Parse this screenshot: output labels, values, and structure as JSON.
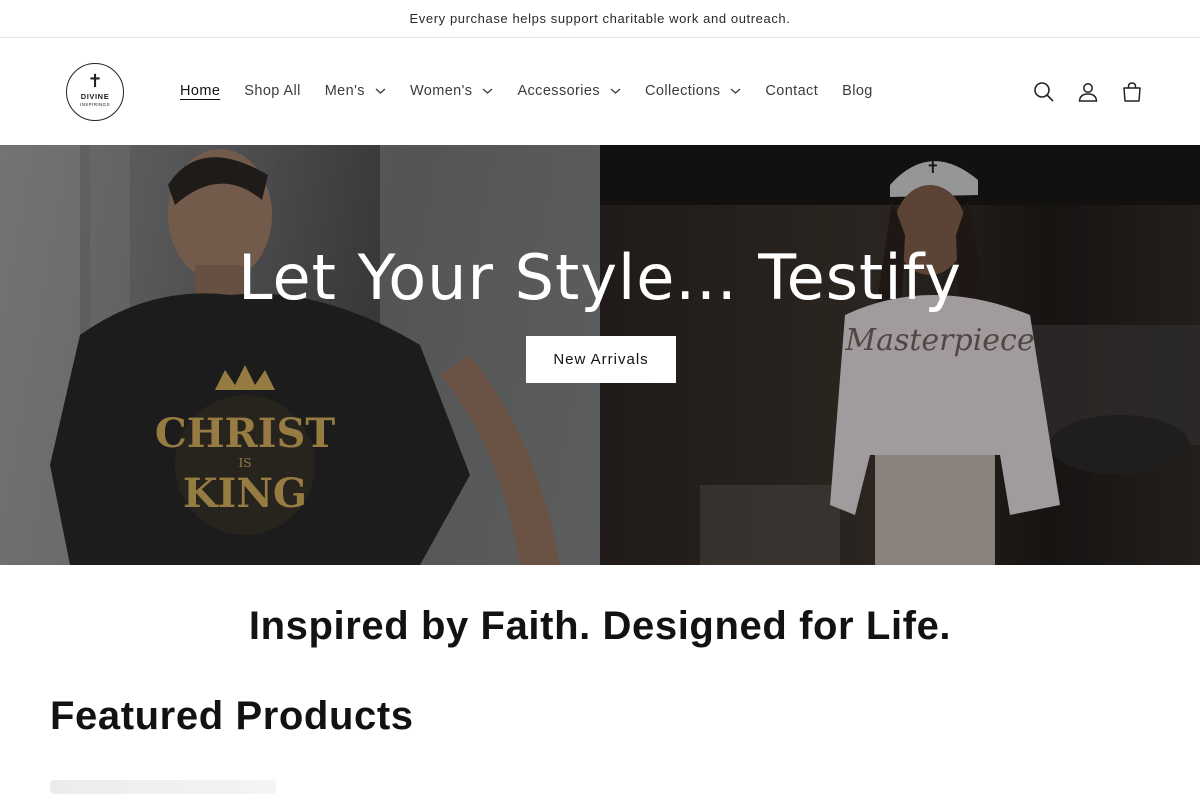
{
  "announcement": "Every purchase helps support charitable work and outreach.",
  "logo": {
    "line1": "DIVINE",
    "line2": "INSPIRINGS",
    "cross": "✝"
  },
  "nav": [
    {
      "label": "Home",
      "active": true,
      "dropdown": false
    },
    {
      "label": "Shop All",
      "active": false,
      "dropdown": false
    },
    {
      "label": "Men's",
      "active": false,
      "dropdown": true
    },
    {
      "label": "Women's",
      "active": false,
      "dropdown": true
    },
    {
      "label": "Accessories",
      "active": false,
      "dropdown": true
    },
    {
      "label": "Collections",
      "active": false,
      "dropdown": true
    },
    {
      "label": "Contact",
      "active": false,
      "dropdown": false
    },
    {
      "label": "Blog",
      "active": false,
      "dropdown": false
    }
  ],
  "header_icons": [
    "search-icon",
    "account-icon",
    "cart-icon"
  ],
  "hero": {
    "title": "Let Your Style... Testify",
    "button": "New Arrivals",
    "left_shirt_text": "CHRIST IS KING",
    "right_shirt_text": "Masterpiece"
  },
  "tagline": "Inspired by Faith. Designed for Life.",
  "featured_heading": "Featured Products",
  "colors": {
    "text": "#121212",
    "button_bg": "#ffffff"
  }
}
